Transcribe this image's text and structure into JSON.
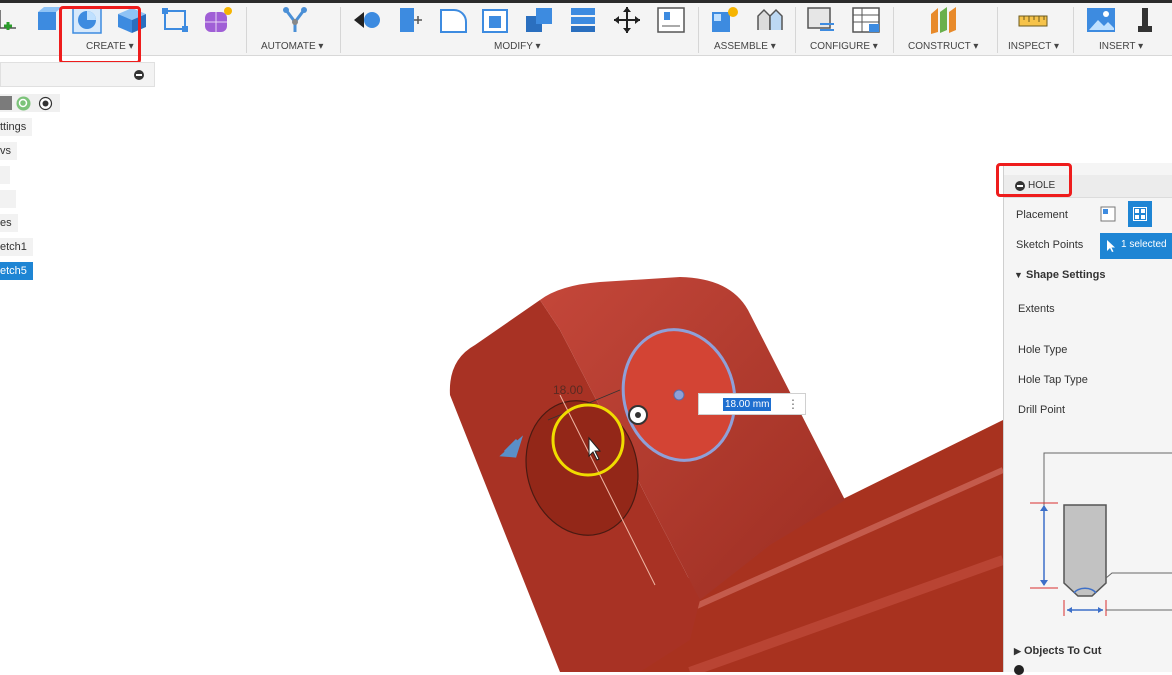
{
  "toolbar": {
    "groups": [
      {
        "label": "CREATE ▾"
      },
      {
        "label": "AUTOMATE ▾"
      },
      {
        "label": "MODIFY ▾"
      },
      {
        "label": "ASSEMBLE ▾"
      },
      {
        "label": "CONFIGURE ▾"
      },
      {
        "label": "CONSTRUCT ▾"
      },
      {
        "label": "INSPECT ▾"
      },
      {
        "label": "INSERT ▾"
      }
    ]
  },
  "browser": {
    "items": [
      {
        "label": "ttings"
      },
      {
        "label": "vs"
      },
      {
        "label": "es"
      },
      {
        "label": "etch1"
      },
      {
        "label": "etch5"
      }
    ]
  },
  "viewport": {
    "sketch_dimension": "18.00",
    "dimension_input_value": "18.00 mm"
  },
  "hole_panel": {
    "title": "HOLE",
    "placement_label": "Placement",
    "sketch_points_label": "Sketch Points",
    "sketch_points_value": "1 selected",
    "shape_settings_label": "Shape Settings",
    "extents_label": "Extents",
    "hole_type_label": "Hole Type",
    "hole_tap_type_label": "Hole Tap Type",
    "drill_point_label": "Drill Point",
    "objects_to_cut_label": "Objects To Cut"
  },
  "colors": {
    "accent": "#1e6fd0",
    "highlight": "#ee1c1c",
    "body": "#b3372a",
    "cursor_ring": "#f0dc00"
  }
}
